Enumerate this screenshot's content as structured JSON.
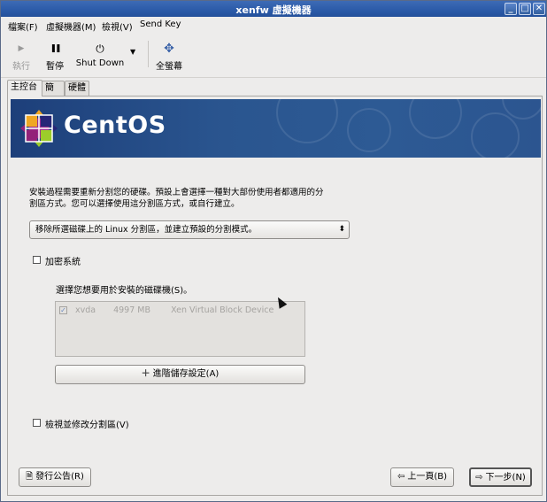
{
  "window": {
    "title": "xenfw 虛擬機器"
  },
  "wm_buttons": {
    "min": "_",
    "max": "□",
    "close": "✕"
  },
  "menu": [
    {
      "label": "檔案(F)"
    },
    {
      "label": "虛擬機器(M)"
    },
    {
      "label": "檢視(V)"
    },
    {
      "label": "Send Key"
    }
  ],
  "toolbar": {
    "run": {
      "label": "執行",
      "icon": "play-icon",
      "glyph": "▶"
    },
    "pause": {
      "label": "暫停",
      "icon": "pause-icon",
      "glyph": "❚❚"
    },
    "shutdown": {
      "label": "Shut Down",
      "icon": "power-icon",
      "glyph": "⏻"
    },
    "dropdown": "▼",
    "fullscreen": {
      "label": "全螢幕",
      "icon": "fullscreen-icon",
      "glyph": "✥"
    }
  },
  "tabs": [
    {
      "label": "主控台",
      "active": true
    },
    {
      "label": "簡介",
      "active": false
    },
    {
      "label": "硬體",
      "active": false
    }
  ],
  "banner": {
    "brand": "CentOS"
  },
  "installer": {
    "description": "安裝過程需要重新分割您的硬碟。預設上會選擇一種對大部份使用者都適用的分割區方式。您可以選擇使用這分割區方式，或自行建立。",
    "partition_select": "移除所選磁碟上的 Linux 分割區，並建立預設的分割模式。",
    "select_arrow": "⬍",
    "encrypt_label": "加密系統",
    "disk_prompt": "選擇您想要用於安裝的磁碟機(S)。",
    "disks": [
      {
        "checked": true,
        "name": "xvda",
        "size": "4997 MB",
        "model": "Xen Virtual Block Device"
      }
    ],
    "advanced_button": "進階儲存設定(A)",
    "advanced_icon": "＋",
    "review_label": "檢視並修改分割區(V)",
    "release_notes_button": "發行公告(R)",
    "back_button": "上一頁(B)",
    "next_button": "下一步(N)",
    "back_icon": "⇦",
    "next_icon": "⇨",
    "notes_icon": "🗎"
  },
  "colors": {
    "titlebar": "#2b5aa8",
    "banner": "#2a558f"
  }
}
